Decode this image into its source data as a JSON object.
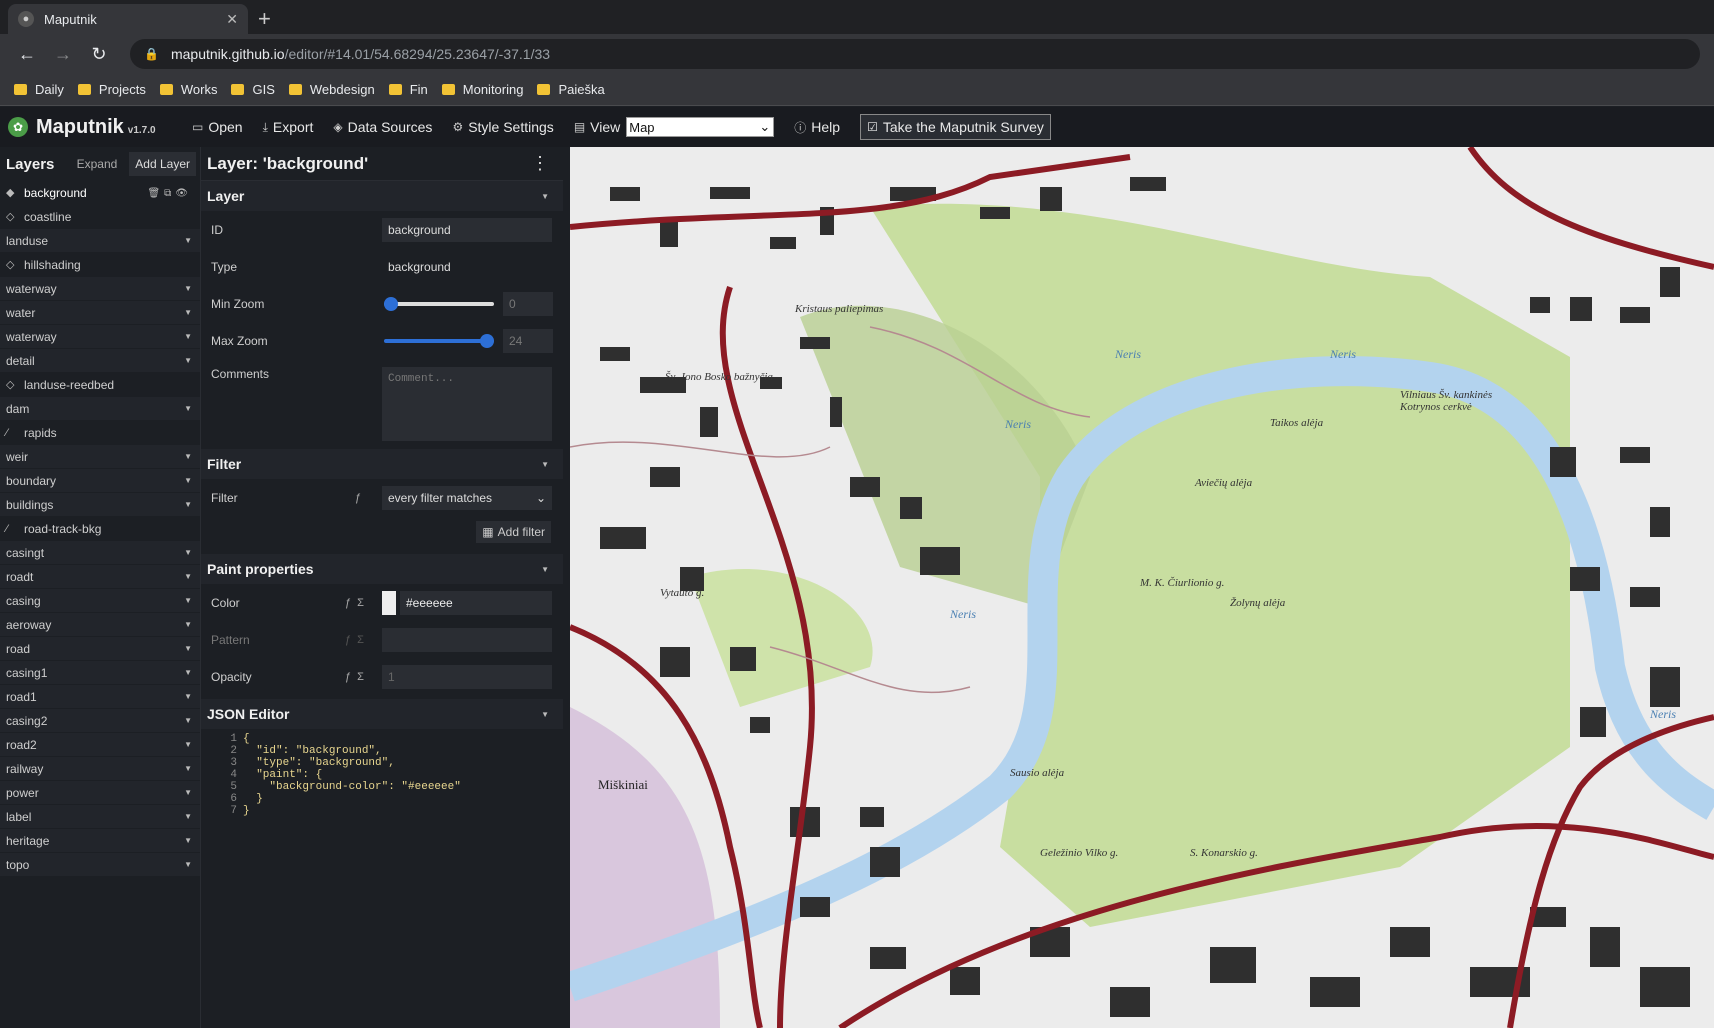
{
  "browser": {
    "tab_title": "Maputnik",
    "url_host": "maputnik.github.io",
    "url_path": "/editor/#14.01/54.68294/25.23647/-37.1/33",
    "bookmarks": [
      "Daily",
      "Projects",
      "Works",
      "GIS",
      "Webdesign",
      "Fin",
      "Monitoring",
      "Paieška"
    ]
  },
  "app": {
    "name": "Maputnik",
    "version": "v1.7.0",
    "toolbar": {
      "open": "Open",
      "export": "Export",
      "data_sources": "Data Sources",
      "style_settings": "Style Settings",
      "view": "View",
      "view_value": "Map",
      "help": "Help",
      "survey": "Take the Maputnik Survey"
    }
  },
  "layers_panel": {
    "title": "Layers",
    "expand": "Expand",
    "add_layer": "Add Layer",
    "items": [
      {
        "label": "background",
        "kind": "layer",
        "icon": "diamond-filled-icon"
      },
      {
        "label": "coastline",
        "kind": "layer",
        "icon": "diamond-outline-icon"
      },
      {
        "label": "landuse",
        "kind": "group"
      },
      {
        "label": "hillshading",
        "kind": "layer",
        "icon": "diamond-outline-icon"
      },
      {
        "label": "waterway",
        "kind": "group"
      },
      {
        "label": "water",
        "kind": "group"
      },
      {
        "label": "waterway",
        "kind": "group"
      },
      {
        "label": "detail",
        "kind": "group"
      },
      {
        "label": "landuse-reedbed",
        "kind": "layer",
        "icon": "diamond-outline-icon"
      },
      {
        "label": "dam",
        "kind": "group"
      },
      {
        "label": "rapids",
        "kind": "layer",
        "icon": "line-icon"
      },
      {
        "label": "weir",
        "kind": "group"
      },
      {
        "label": "boundary",
        "kind": "group"
      },
      {
        "label": "buildings",
        "kind": "group"
      },
      {
        "label": "road-track-bkg",
        "kind": "layer",
        "icon": "line-icon"
      },
      {
        "label": "casingt",
        "kind": "group"
      },
      {
        "label": "roadt",
        "kind": "group"
      },
      {
        "label": "casing",
        "kind": "group"
      },
      {
        "label": "aeroway",
        "kind": "group"
      },
      {
        "label": "road",
        "kind": "group"
      },
      {
        "label": "casing1",
        "kind": "group"
      },
      {
        "label": "road1",
        "kind": "group"
      },
      {
        "label": "casing2",
        "kind": "group"
      },
      {
        "label": "road2",
        "kind": "group"
      },
      {
        "label": "railway",
        "kind": "group"
      },
      {
        "label": "power",
        "kind": "group"
      },
      {
        "label": "label",
        "kind": "group"
      },
      {
        "label": "heritage",
        "kind": "group"
      },
      {
        "label": "topo",
        "kind": "group"
      }
    ]
  },
  "editor": {
    "title": "Layer: 'background'",
    "layer_section": "Layer",
    "id_label": "ID",
    "id_value": "background",
    "type_label": "Type",
    "type_value": "background",
    "minzoom_label": "Min Zoom",
    "minzoom_value": "0",
    "minzoom_fraction": 0,
    "maxzoom_label": "Max Zoom",
    "maxzoom_value": "24",
    "maxzoom_fraction": 1,
    "comments_label": "Comments",
    "comments_placeholder": "Comment...",
    "filter_section": "Filter",
    "filter_label": "Filter",
    "filter_value": "every filter matches",
    "add_filter": "Add filter",
    "paint_section": "Paint properties",
    "color_label": "Color",
    "color_value": "#eeeeee",
    "pattern_label": "Pattern",
    "opacity_label": "Opacity",
    "opacity_value": "1",
    "json_section": "JSON Editor",
    "json_lines": [
      "{",
      "  \"id\": \"background\",",
      "  \"type\": \"background\",",
      "  \"paint\": {",
      "    \"background-color\": \"#eeeeee\"",
      "  }",
      "}"
    ]
  },
  "map": {
    "labels": [
      "Neris",
      "Neris",
      "Neris",
      "Neris",
      "Neris",
      "Taikos alėja",
      "Aviečių alėja",
      "M. K. Čiurlionio g.",
      "Miškiniai",
      "Geležinio Vilko g.",
      "S. Konarskio g.",
      "Vilniaus Šv. kankinės Kotrynos cerkvė",
      "Kristaus paliepimas",
      "Šv. Jono Bosko bažnyčia",
      "Sausio alėja",
      "Žolynų alėja",
      "Vytauto g."
    ]
  },
  "colors": {
    "accent": "#2d6fd6",
    "road": "#8c1b24",
    "water": "#b3d3ee",
    "park": "#c8dea0",
    "building": "#2f2f2f"
  }
}
